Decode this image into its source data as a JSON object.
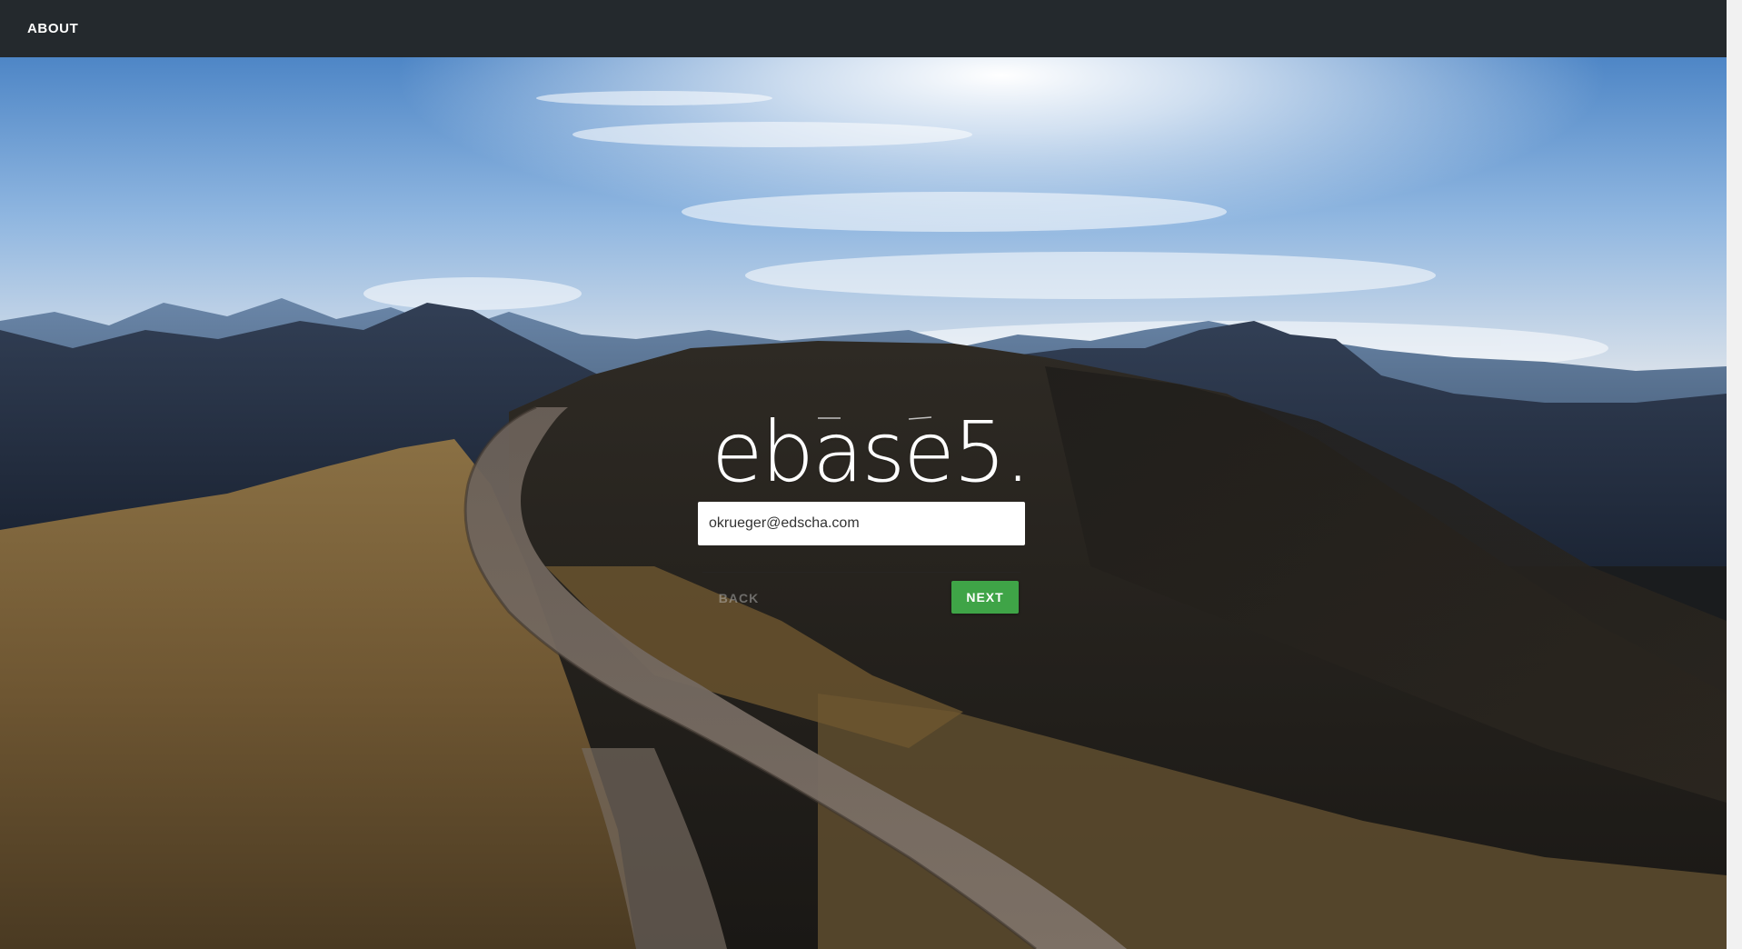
{
  "nav": {
    "about_label": "ABOUT"
  },
  "login": {
    "brand": "ebase5.",
    "email_value": "okrueger@edscha.com",
    "back_label": "BACK",
    "next_label": "NEXT"
  },
  "colors": {
    "topbar": "#24292d",
    "next_button": "#3fa447"
  }
}
